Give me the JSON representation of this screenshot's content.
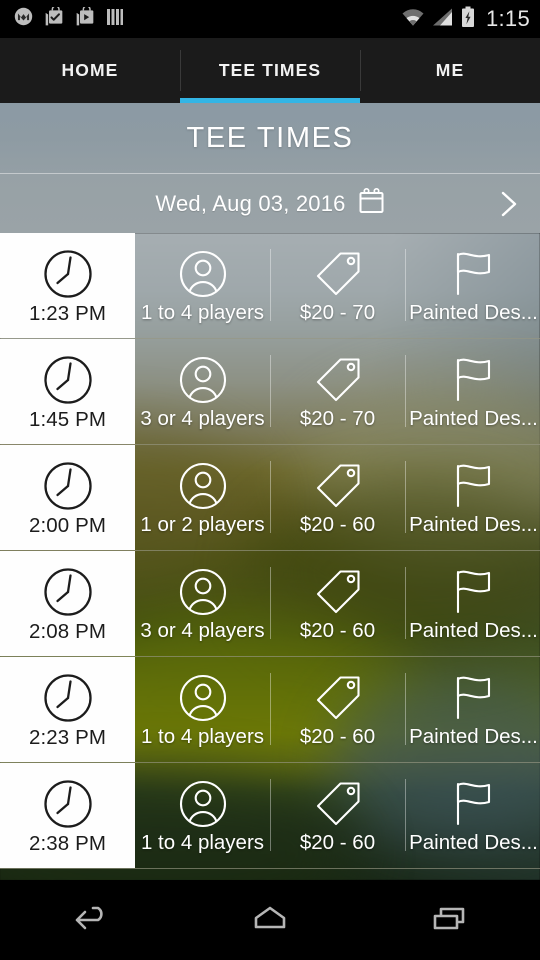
{
  "status_bar": {
    "time": "1:15",
    "left_icons": [
      "motorola-logo-icon",
      "app-check-icon",
      "app-play-icon",
      "bars-icon"
    ],
    "right_icons": [
      "wifi-icon",
      "signal-icon",
      "battery-charging-icon"
    ]
  },
  "tabs": [
    {
      "label": "HOME",
      "active": false
    },
    {
      "label": "TEE TIMES",
      "active": true
    },
    {
      "label": "ME",
      "active": false
    }
  ],
  "accent_color": "#33b5e5",
  "header": {
    "title": "TEE TIMES",
    "date": "Wed, Aug 03, 2016",
    "calendar_icon": "calendar-icon",
    "next_icon": "chevron-right-icon"
  },
  "list": {
    "columns": [
      "time",
      "players",
      "price",
      "course"
    ],
    "rows": [
      {
        "time": "1:23 PM",
        "players": "1 to 4 players",
        "price": "$20 - 70",
        "course": "Painted Des..."
      },
      {
        "time": "1:45 PM",
        "players": "3 or 4 players",
        "price": "$20 - 70",
        "course": "Painted Des..."
      },
      {
        "time": "2:00 PM",
        "players": "1 or 2 players",
        "price": "$20 - 60",
        "course": "Painted Des..."
      },
      {
        "time": "2:08 PM",
        "players": "3 or 4 players",
        "price": "$20 - 60",
        "course": "Painted Des..."
      },
      {
        "time": "2:23 PM",
        "players": "1 to 4 players",
        "price": "$20 - 60",
        "course": "Painted Des..."
      },
      {
        "time": "2:38 PM",
        "players": "1 to 4 players",
        "price": "$20 - 60",
        "course": "Painted Des..."
      }
    ]
  },
  "nav_bar": {
    "buttons": [
      "back-icon",
      "home-icon",
      "recents-icon"
    ]
  }
}
